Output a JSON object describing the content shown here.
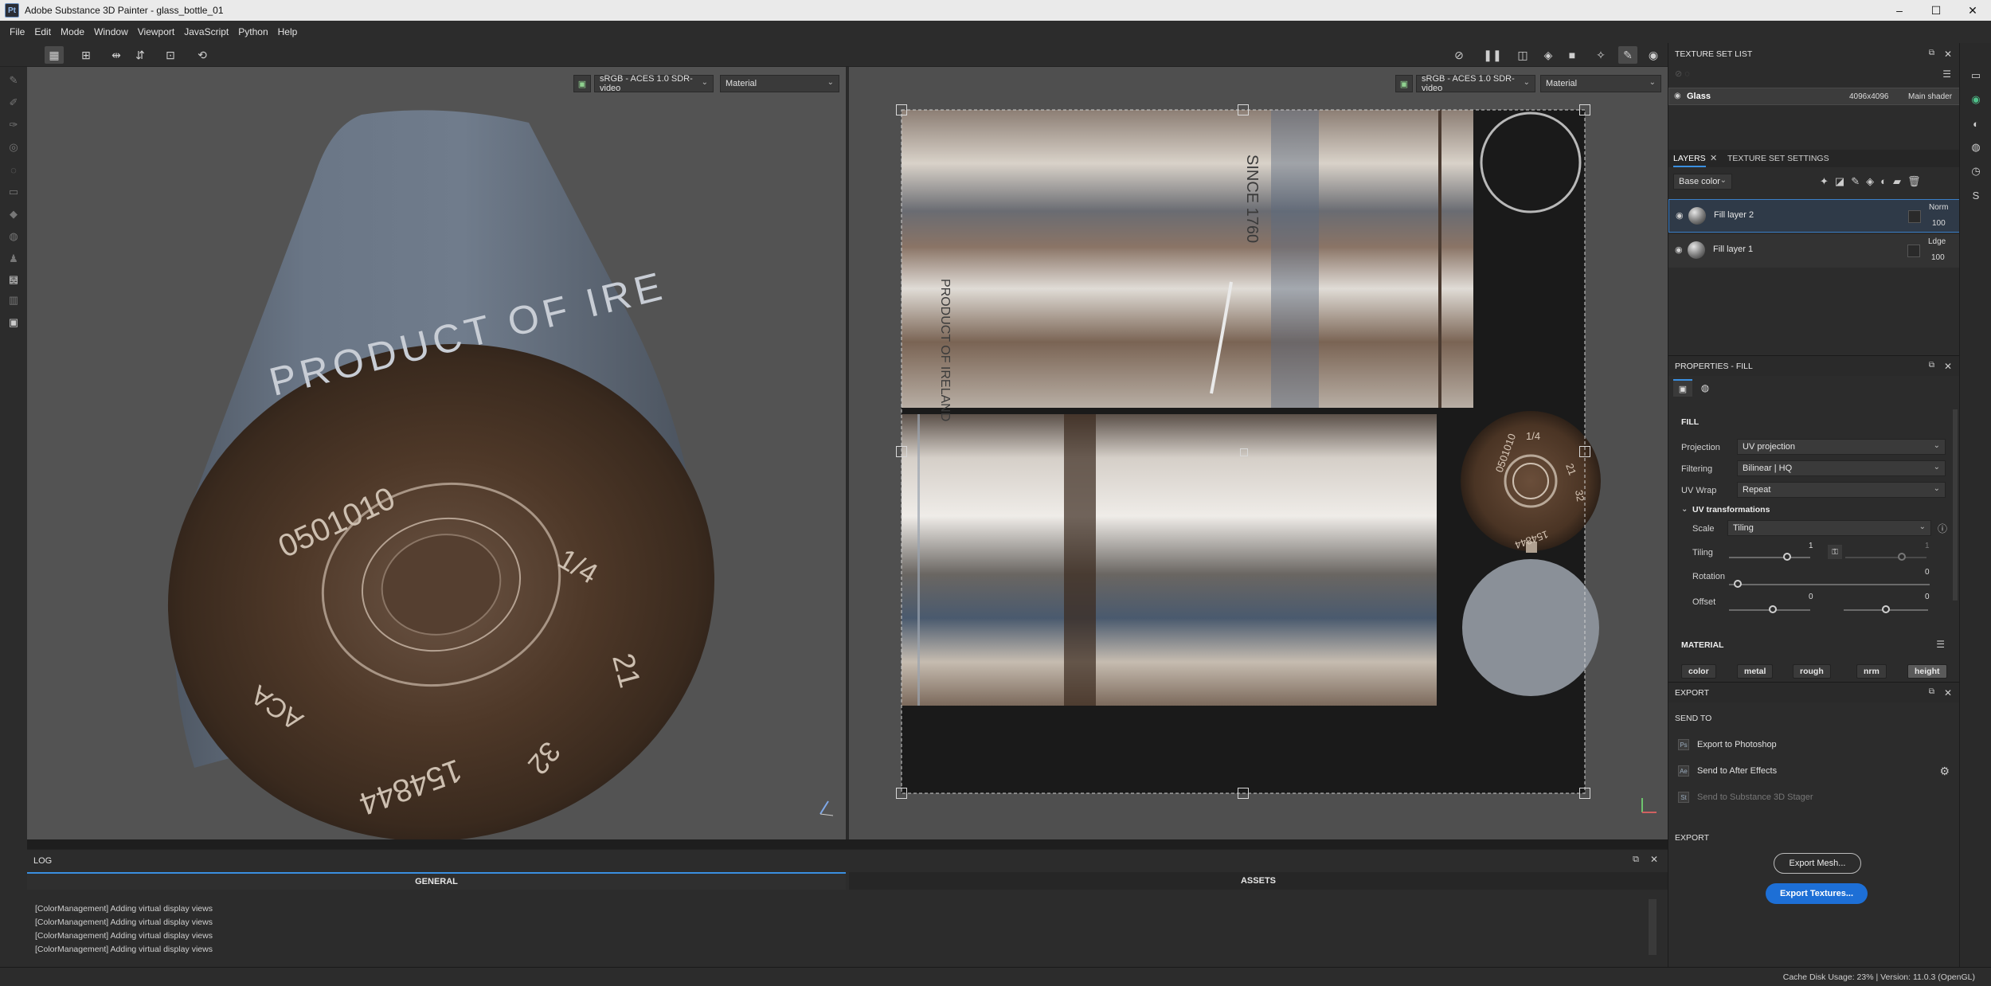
{
  "window": {
    "app_icon": "Pt",
    "title": "Adobe Substance 3D Painter - glass_bottle_01",
    "min": "–",
    "max": "☐",
    "close": "✕"
  },
  "menu": [
    "File",
    "Edit",
    "Mode",
    "Window",
    "Viewport",
    "JavaScript",
    "Python",
    "Help"
  ],
  "viewport3d": {
    "colorspace": "sRGB - ACES 1.0 SDR-video",
    "channel": "Material",
    "engraving_top": "PRODUCT OF IRE",
    "engraving_bottom1": "0501010",
    "engraving_bottom2": "1/4",
    "engraving_bottom3": "21",
    "engraving_bottom4": "32",
    "engraving_bottom5": "154844",
    "engraving_bottom6": "ACA"
  },
  "viewport2d": {
    "colorspace": "sRGB - ACES 1.0 SDR-video",
    "channel": "Material",
    "uv_text_since": "SINCE 1760",
    "uv_text_product": "PRODUCT OF IRELAND",
    "uv_text_disc1": "0501010",
    "uv_text_disc2": "1/4",
    "uv_text_disc3": "21",
    "uv_text_disc4": "32",
    "uv_text_disc5": "154844"
  },
  "log": {
    "title": "LOG",
    "tabs": [
      "GENERAL",
      "ASSETS"
    ],
    "lines": [
      "[ColorManagement] Adding virtual display views",
      "[ColorManagement] Adding virtual display views",
      "[ColorManagement] Adding virtual display views",
      "[ColorManagement] Adding virtual display views"
    ]
  },
  "texture_set_list": {
    "title": "TEXTURE SET LIST",
    "item": {
      "name": "Glass",
      "size": "4096x4096",
      "shader": "Main shader"
    }
  },
  "layers": {
    "tabs": [
      "LAYERS",
      "TEXTURE SET SETTINGS"
    ],
    "channel": "Base color",
    "items": [
      {
        "name": "Fill layer 2",
        "blend": "Norm",
        "opacity": "100"
      },
      {
        "name": "Fill layer 1",
        "blend": "Ldge",
        "opacity": "100"
      }
    ]
  },
  "properties": {
    "title": "PROPERTIES - FILL",
    "section": "FILL",
    "projection": {
      "label": "Projection",
      "value": "UV projection"
    },
    "filtering": {
      "label": "Filtering",
      "value": "Bilinear | HQ"
    },
    "uvwrap": {
      "label": "UV Wrap",
      "value": "Repeat"
    },
    "uvtrans": "UV transformations",
    "scale": {
      "label": "Scale",
      "value": "Tiling"
    },
    "tiling": {
      "label": "Tiling",
      "a": "1",
      "b": "1"
    },
    "rotation": {
      "label": "Rotation",
      "value": "0"
    },
    "offset": {
      "label": "Offset",
      "a": "0",
      "b": "0"
    },
    "material": "MATERIAL",
    "chips": [
      "color",
      "metal",
      "rough",
      "nrm",
      "height"
    ]
  },
  "export": {
    "title": "EXPORT",
    "send_to": "SEND TO",
    "items": [
      "Export to Photoshop",
      "Send to After Effects",
      "Send to Substance 3D Stager"
    ],
    "section2": "EXPORT",
    "mesh_btn": "Export Mesh...",
    "tex_btn": "Export Textures..."
  },
  "status": "Cache Disk Usage:    23% | Version: 11.0.3 (OpenGL)",
  "colors": {
    "accent": "#3a8fe0",
    "button_blue": "#1d6fd6",
    "panel": "#2c2c2c",
    "viewport": "#535353"
  }
}
